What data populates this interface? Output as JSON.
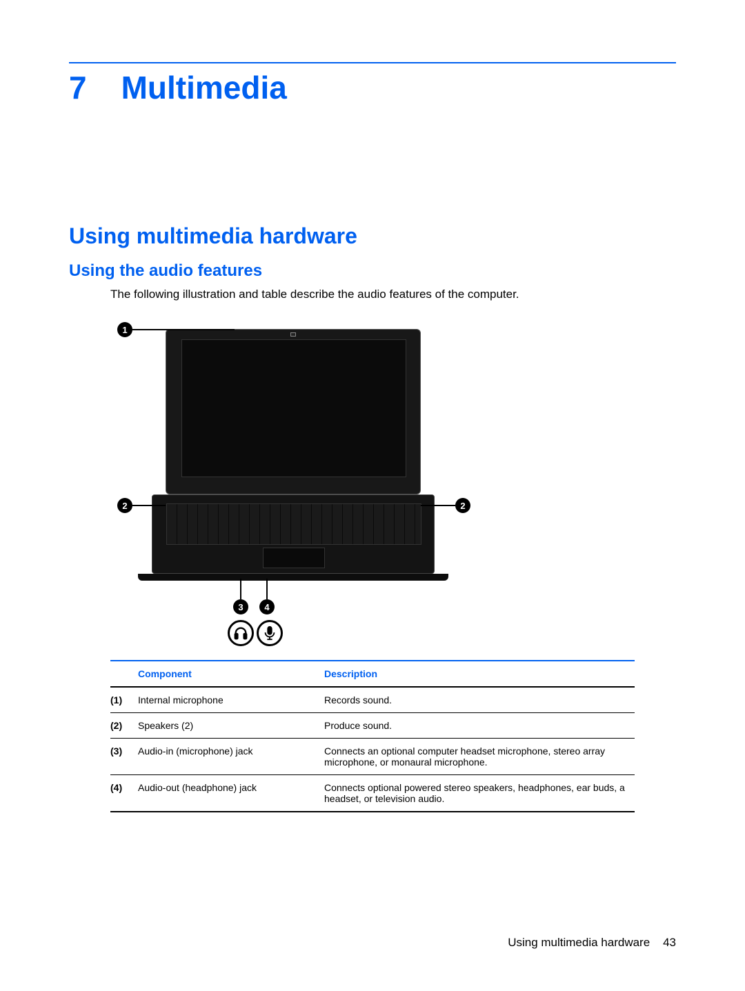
{
  "chapter": {
    "number": "7",
    "title": "Multimedia"
  },
  "section": {
    "title": "Using multimedia hardware"
  },
  "subsection": {
    "title": "Using the audio features"
  },
  "intro_text": "The following illustration and table describe the audio features of the computer.",
  "callouts": {
    "c1": "1",
    "c2l": "2",
    "c2r": "2",
    "c3": "3",
    "c4": "4"
  },
  "table": {
    "headers": {
      "component": "Component",
      "description": "Description"
    },
    "rows": [
      {
        "idx": "(1)",
        "component": "Internal microphone",
        "description": "Records sound."
      },
      {
        "idx": "(2)",
        "component": "Speakers (2)",
        "description": "Produce sound."
      },
      {
        "idx": "(3)",
        "component": "Audio-in (microphone) jack",
        "description": "Connects an optional computer headset microphone, stereo array microphone, or monaural microphone."
      },
      {
        "idx": "(4)",
        "component": "Audio-out (headphone) jack",
        "description": "Connects optional powered stereo speakers, headphones, ear buds, a headset, or television audio."
      }
    ]
  },
  "footer": {
    "text": "Using multimedia hardware",
    "page": "43"
  }
}
